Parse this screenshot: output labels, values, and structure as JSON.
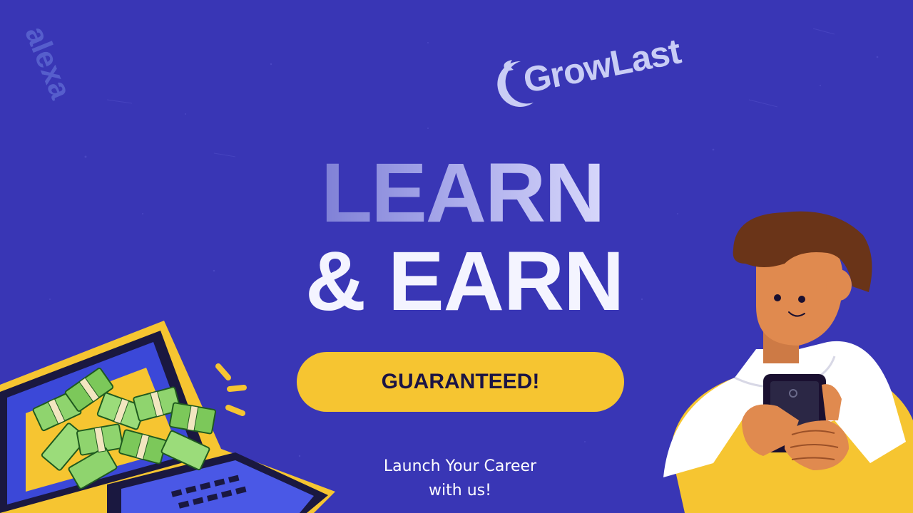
{
  "background_color": "#3936b5",
  "watermark": {
    "text": "alexa"
  },
  "logo": {
    "text": "GrowLast",
    "icon": "growlast-crescent-icon"
  },
  "headline": {
    "line1": "LEARN",
    "line2": "& EARN"
  },
  "cta": {
    "label": "GUARANTEED!",
    "color": "#f6c531"
  },
  "tagline": {
    "line1": "Launch Your Career",
    "line2": "with us!"
  },
  "illustrations": {
    "left": "laptop-with-cash-stacks-icon",
    "right": "person-holding-phone-illustration"
  }
}
